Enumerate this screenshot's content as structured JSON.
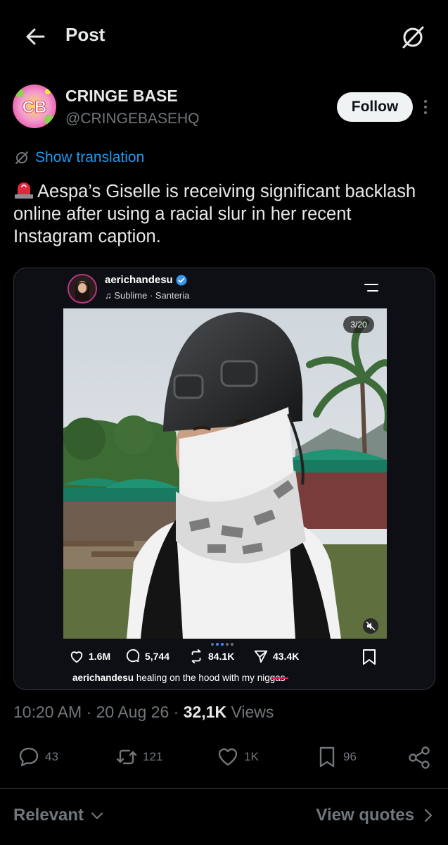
{
  "header": {
    "title": "Post"
  },
  "author": {
    "name": "CRINGE BASE",
    "handle": "@CRINGEBASEHQ",
    "avatar_text": "CB",
    "follow_label": "Follow"
  },
  "translation": {
    "label": "Show translation"
  },
  "tweet": {
    "text": "Aespa’s Giselle is receiving significant backlash online after using a racial slur in her recent Instagram caption."
  },
  "media": {
    "ig_username": "aerichandesu",
    "ig_music": "Sublime · Santeria",
    "counter": "3/20",
    "likes": "1.6M",
    "comments": "5,744",
    "reposts": "84.1K",
    "shares": "43.4K",
    "caption_user": "aerichandesu",
    "caption_text": "healing on the hood with my",
    "caption_redacted": "niggas"
  },
  "meta": {
    "time": "10:20 AM",
    "date": "20 Aug 26",
    "views_count": "32,1K",
    "views_label": "Views"
  },
  "stats": {
    "replies": "43",
    "reposts": "121",
    "likes": "1K",
    "bookmarks": "96"
  },
  "bottom": {
    "relevant_label": "Relevant",
    "view_quotes_label": "View quotes"
  },
  "colors": {
    "background": "#000000",
    "link": "#1d9bf0",
    "muted": "#71767b",
    "text": "#e7e9ea"
  }
}
